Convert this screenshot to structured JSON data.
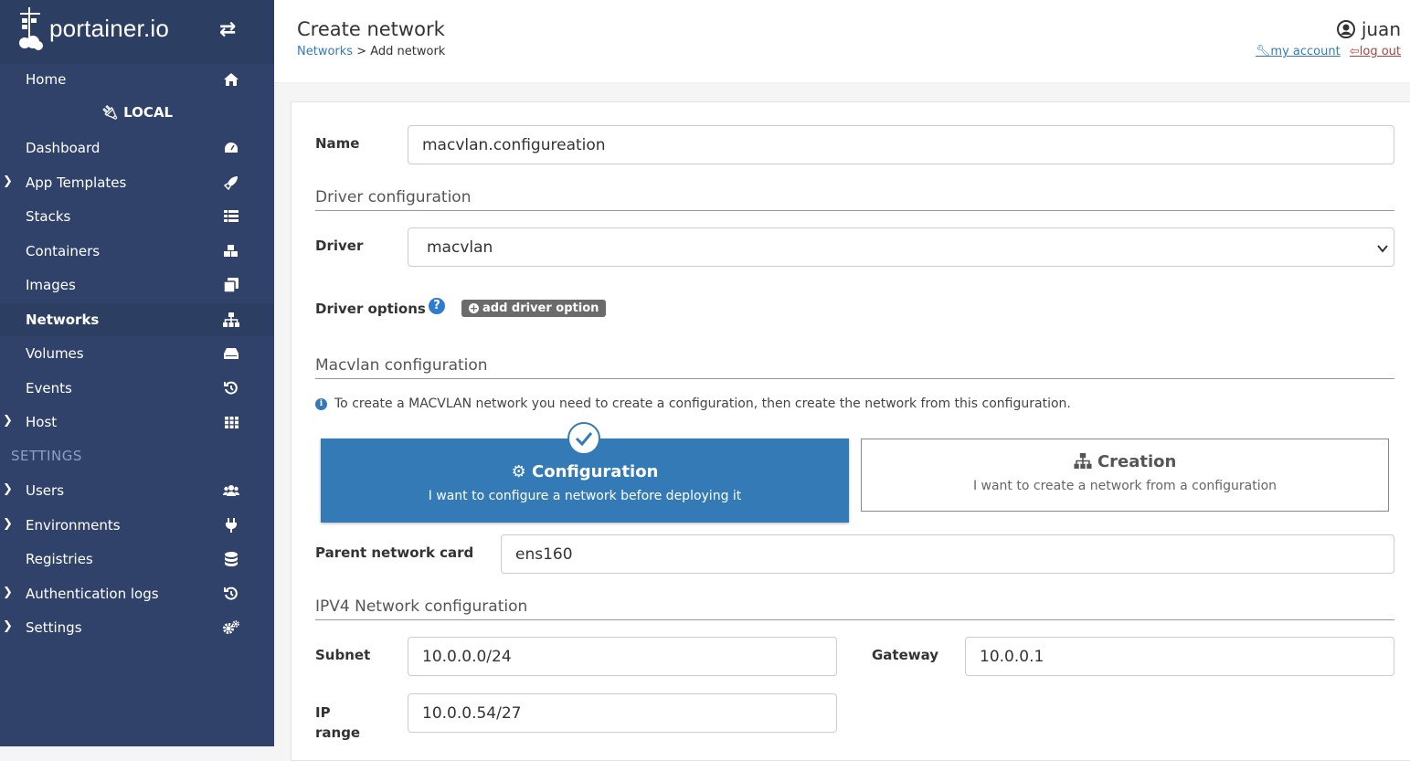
{
  "sidebar": {
    "brand": "portainer.io",
    "home": "Home",
    "environment": "LOCAL",
    "items": [
      {
        "label": "Dashboard",
        "icon": "dashboard-icon"
      },
      {
        "label": "App Templates",
        "icon": "rocket-icon"
      },
      {
        "label": "Stacks",
        "icon": "stacks-icon"
      },
      {
        "label": "Containers",
        "icon": "cubes-icon"
      },
      {
        "label": "Images",
        "icon": "images-icon"
      },
      {
        "label": "Networks",
        "icon": "sitemap-icon"
      },
      {
        "label": "Volumes",
        "icon": "hdd-icon"
      },
      {
        "label": "Events",
        "icon": "history-icon"
      },
      {
        "label": "Host",
        "icon": "grid-icon"
      }
    ],
    "settings_header": "SETTINGS",
    "settings_items": [
      {
        "label": "Users",
        "icon": "users-icon"
      },
      {
        "label": "Environments",
        "icon": "plug-icon"
      },
      {
        "label": "Registries",
        "icon": "database-icon"
      },
      {
        "label": "Authentication logs",
        "icon": "history-icon"
      },
      {
        "label": "Settings",
        "icon": "cogs-icon"
      }
    ]
  },
  "header": {
    "title": "Create network",
    "breadcrumb_link": "Networks",
    "breadcrumb_current": "> Add network",
    "username": "juan",
    "my_account": "my account",
    "log_out": "log out"
  },
  "form": {
    "name_label": "Name",
    "name_value": "macvlan.configureation",
    "driver_section": "Driver configuration",
    "driver_label": "Driver",
    "driver_value": "macvlan",
    "driver_options_label": "Driver options",
    "add_driver_option": "add driver option",
    "macvlan_section": "Macvlan configuration",
    "macvlan_info": "To create a MACVLAN network you need to create a configuration, then create the network from this configuration.",
    "config_title": "Configuration",
    "config_desc": "I want to configure a network before deploying it",
    "creation_title": "Creation",
    "creation_desc": "I want to create a network from a configuration",
    "parent_label": "Parent network card",
    "parent_value": "ens160",
    "ipv4_section": "IPV4 Network configuration",
    "subnet_label": "Subnet",
    "subnet_value": "10.0.0.0/24",
    "gateway_label": "Gateway",
    "gateway_value": "10.0.0.1",
    "iprange_label": "IP range",
    "iprange_value": "10.0.0.54/27"
  }
}
